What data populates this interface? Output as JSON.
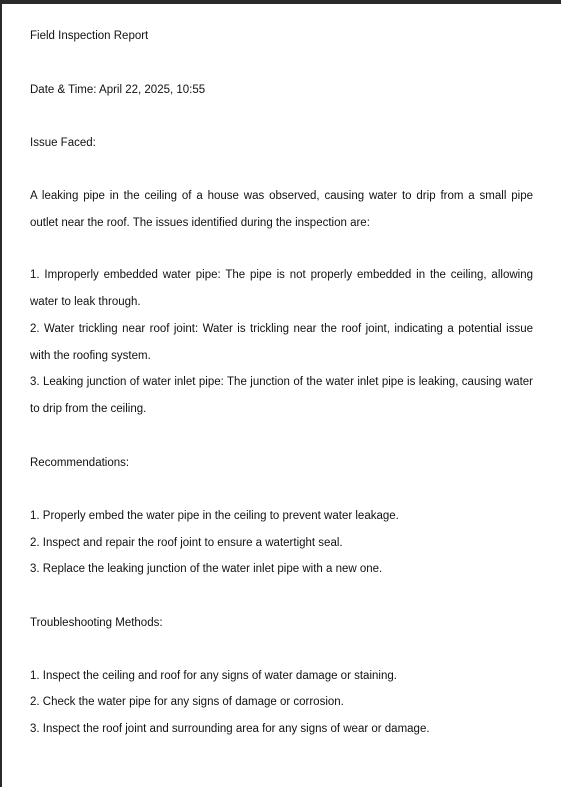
{
  "report": {
    "title": "Field Inspection Report",
    "datetime": "Date & Time: April 22, 2025, 10:55",
    "issue_heading": "Issue Faced:",
    "issue_intro": "A leaking pipe in the ceiling of a house was observed, causing water to drip from a small pipe outlet near the roof. The issues identified during the inspection are:",
    "issues": [
      "1. Improperly embedded water pipe: The pipe is not properly embedded in the ceiling, allowing water to leak through.",
      "2. Water trickling near roof joint: Water is trickling near the roof joint, indicating a potential issue with the roofing system.",
      "3. Leaking junction of water inlet pipe: The junction of the water inlet pipe is leaking, causing water to drip from the ceiling."
    ],
    "recommendations_heading": "Recommendations:",
    "recommendations": [
      "1. Properly embed the water pipe in the ceiling to prevent water leakage.",
      "2. Inspect and repair the roof joint to ensure a watertight seal.",
      "3. Replace the leaking junction of the water inlet pipe with a new one."
    ],
    "troubleshooting_heading": "Troubleshooting Methods:",
    "troubleshooting": [
      "1. Inspect the ceiling and roof for any signs of water damage or staining.",
      "2. Check the water pipe for any signs of damage or corrosion.",
      "3. Inspect the roof joint and surrounding area for any signs of wear or damage."
    ]
  }
}
